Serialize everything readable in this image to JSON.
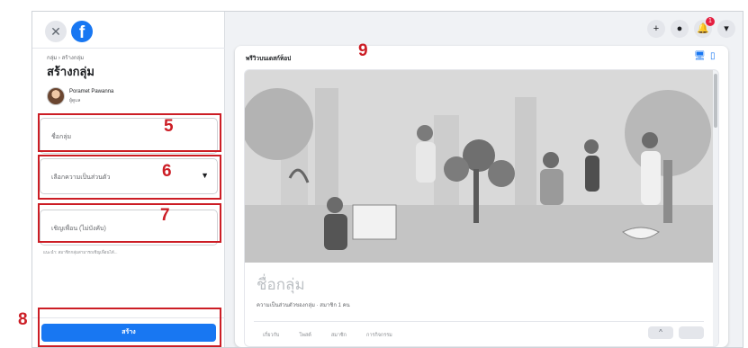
{
  "header": {
    "close_icon": "close-icon",
    "logo_icon": "facebook-logo-icon",
    "actions": [
      {
        "name": "plus-icon",
        "glyph": "+"
      },
      {
        "name": "messenger-icon",
        "glyph": "●"
      },
      {
        "name": "bell-icon",
        "glyph": "🔔",
        "badge": "1"
      },
      {
        "name": "account-menu-icon",
        "glyph": "▾"
      }
    ]
  },
  "left_panel": {
    "breadcrumb": "กลุ่ม › สร้างกลุ่ม",
    "title": "สร้างกลุ่ม",
    "user": {
      "name": "Poramet Pawanna",
      "role": "ผู้ดูแล"
    },
    "fields": {
      "group_name_placeholder": "ชื่อกลุ่ม",
      "privacy_placeholder": "เลือกความเป็นส่วนตัว",
      "invite_placeholder": "เชิญเพื่อน (ไม่บังคับ)"
    },
    "hint": "แนะนำ: สมาชิกกลุ่มสามารถเชิญเพื่อนได้...",
    "create_button": "สร้าง"
  },
  "preview": {
    "label": "พรีวิวบนเดสก์ท็อป",
    "group_name": "ชื่อกลุ่ม",
    "meta": "ความเป็นส่วนตัวของกลุ่ม · สมาชิก 1 คน",
    "tabs": [
      "เกี่ยวกับ",
      "โพสต์",
      "สมาชิก",
      "การกิจกรรม"
    ],
    "devices": [
      {
        "name": "desktop-icon",
        "glyph": "🖥"
      },
      {
        "name": "mobile-icon",
        "glyph": "▯"
      }
    ],
    "tab_actions": [
      {
        "name": "more-options-icon",
        "glyph": "^"
      },
      {
        "name": "search-icon",
        "glyph": ""
      }
    ]
  },
  "annotations": {
    "n5": "5",
    "n6": "6",
    "n7": "7",
    "n8": "8",
    "n9": "9"
  },
  "colors": {
    "accent": "#1877f2",
    "annotation": "#cc1d25",
    "badge": "#e41e3f"
  }
}
